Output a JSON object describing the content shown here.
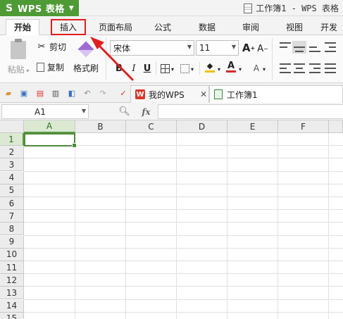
{
  "app": {
    "name": "WPS 表格",
    "doc_title": "工作簿1 - WPS 表格"
  },
  "tabs": [
    {
      "label": "开始",
      "active": true
    },
    {
      "label": "插入",
      "highlighted": true
    },
    {
      "label": "页面布局"
    },
    {
      "label": "公式"
    },
    {
      "label": "数据"
    },
    {
      "label": "审阅"
    },
    {
      "label": "视图"
    },
    {
      "label": "开发"
    }
  ],
  "ribbon": {
    "paste_label": "粘贴",
    "cut_label": "剪切",
    "copy_label": "复制",
    "format_painter_label": "格式刷",
    "font_name": "宋体",
    "font_size": "11",
    "bold": "B",
    "italic": "I",
    "underline": "U",
    "grow_font": "A",
    "shrink_font": "A",
    "font_color_glyph": "A",
    "colors": {
      "fill": "#f2c200",
      "font": "#d62b2b",
      "accent": "#4e9a35"
    }
  },
  "doc_tabs": [
    {
      "label": "我的WPS",
      "badge": "W"
    },
    {
      "label": "工作簿1",
      "active": true
    }
  ],
  "formula_bar": {
    "name_box": "A1",
    "fx": "fx",
    "value": ""
  },
  "sheet": {
    "columns": [
      "A",
      "B",
      "C",
      "D",
      "E",
      "F"
    ],
    "rows": [
      "1",
      "2",
      "3",
      "4",
      "5",
      "6",
      "7",
      "8",
      "9",
      "10",
      "11",
      "12",
      "13",
      "14",
      "15"
    ],
    "selected_cell": "A1"
  }
}
